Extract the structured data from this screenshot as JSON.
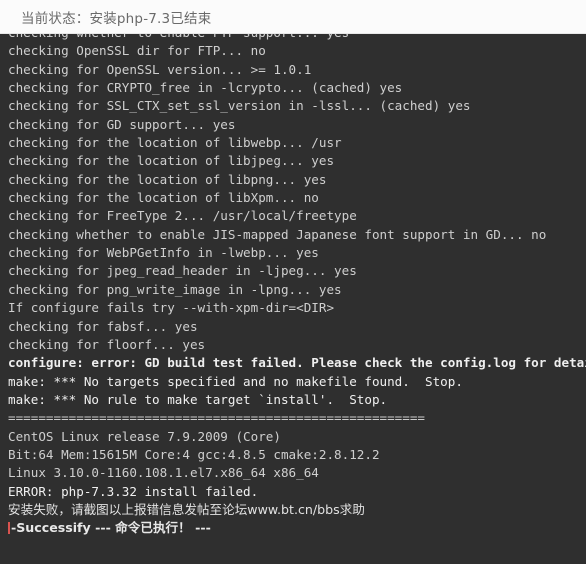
{
  "header": {
    "status_label": "当前状态：安装php-7.3已结束"
  },
  "terminal": {
    "cursor_color": "#d9534f",
    "background_color": "#2f2f2f",
    "text_color": "#d7d7d7",
    "lines": [
      "checking whether to enable FTP support... yes",
      "checking OpenSSL dir for FTP... no",
      "checking for OpenSSL version... >= 1.0.1",
      "checking for CRYPTO_free in -lcrypto... (cached) yes",
      "checking for SSL_CTX_set_ssl_version in -lssl... (cached) yes",
      "checking for GD support... yes",
      "checking for the location of libwebp... /usr",
      "checking for the location of libjpeg... yes",
      "checking for the location of libpng... yes",
      "checking for the location of libXpm... no",
      "checking for FreeType 2... /usr/local/freetype",
      "checking whether to enable JIS-mapped Japanese font support in GD... no",
      "checking for WebPGetInfo in -lwebp... yes",
      "checking for jpeg_read_header in -ljpeg... yes",
      "checking for png_write_image in -lpng... yes",
      "If configure fails try --with-xpm-dir=<DIR>",
      "checking for fabsf... yes",
      "checking for floorf... yes",
      "configure: error: GD build test failed. Please check the config.log for details.",
      "make: *** No targets specified and no makefile found.  Stop.",
      "make: *** No rule to make target `install'.  Stop.",
      "=======================================================",
      "CentOS Linux release 7.9.2009 (Core)",
      "Bit:64 Mem:15615M Core:4 gcc:4.8.5 cmake:2.8.12.2",
      "Linux 3.10.0-1160.108.1.el7.x86_64 x86_64",
      "ERROR: php-7.3.32 install failed.",
      "安装失败，请截图以上报错信息发帖至论坛www.bt.cn/bbs求助"
    ],
    "final_line": "-Successify --- 命令已执行！ ---"
  }
}
